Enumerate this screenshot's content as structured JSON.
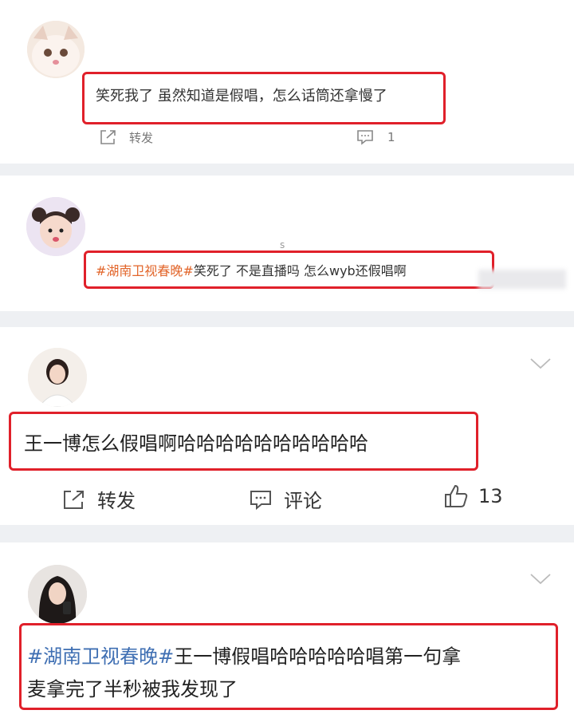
{
  "post1": {
    "text": "笑死我了 虽然知道是假唱，怎么话筒还拿慢了",
    "repost_label": "转发",
    "comment_count": "1"
  },
  "post2": {
    "hashtag": "#湖南卫视春晚#",
    "text": "笑死了 不是直播吗 怎么wyb还假唱啊",
    "stray_char": "s"
  },
  "post3": {
    "text": "王一博怎么假唱啊哈哈哈哈哈哈哈哈哈哈",
    "repost_label": "转发",
    "comment_label": "评论",
    "like_count": "13"
  },
  "post4": {
    "hashtag": "#湖南卫视春晚#",
    "text_line1": "王一博假唱哈哈哈哈哈唱第一句拿",
    "text_line2": "麦拿完了半秒被我发现了"
  },
  "colors": {
    "highlight_box": "#e0202a",
    "hashtag_orange": "#e2652a",
    "hashtag_blue": "#3f6fb3"
  }
}
